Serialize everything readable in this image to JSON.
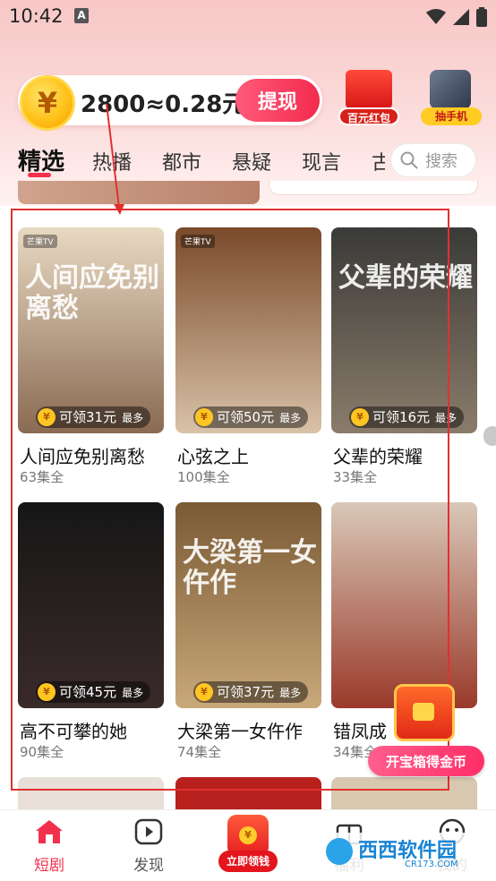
{
  "status_bar": {
    "time": "10:42",
    "app_letter": "A"
  },
  "coin": {
    "amount_text": "2800≈0.28元",
    "coin_symbol": "¥",
    "withdraw_label": "提现"
  },
  "promos": [
    {
      "label": "百元红包",
      "icon": "red-envelope"
    },
    {
      "label": "抽手机",
      "icon": "phone"
    }
  ],
  "tabs": [
    {
      "label": "精选",
      "active": true
    },
    {
      "label": "热播"
    },
    {
      "label": "都市"
    },
    {
      "label": "悬疑"
    },
    {
      "label": "现言"
    },
    {
      "label": "古"
    }
  ],
  "search": {
    "placeholder": "搜索"
  },
  "dramas": [
    {
      "title": "人间应免别离愁",
      "episodes": "63集全",
      "reward": "可领31元",
      "reward_suffix": "最多",
      "poster_text": "人间应免别离愁",
      "poster_brand": "芒果TV",
      "color_a": "#e8d9c2",
      "color_b": "#8a6a52"
    },
    {
      "title": "心弦之上",
      "episodes": "100集全",
      "reward": "可领50元",
      "reward_suffix": "最多",
      "poster_text": "",
      "poster_brand": "芒果TV",
      "color_a": "#7a4a2a",
      "color_b": "#d9c2a8"
    },
    {
      "title": "父辈的荣耀",
      "episodes": "33集全",
      "reward": "可领16元",
      "reward_suffix": "最多",
      "poster_text": "父辈的荣耀",
      "poster_brand": "",
      "color_a": "#3a3a38",
      "color_b": "#8a7c6a"
    },
    {
      "title": "高不可攀的她",
      "episodes": "90集全",
      "reward": "可领45元",
      "reward_suffix": "最多",
      "poster_text": "",
      "poster_brand": "",
      "color_a": "#161616",
      "color_b": "#3a2a2a"
    },
    {
      "title": "大梁第一女仵作",
      "episodes": "74集全",
      "reward": "可领37元",
      "reward_suffix": "最多",
      "poster_text": "大梁第一女仵作",
      "poster_brand": "",
      "color_a": "#7a5a34",
      "color_b": "#c9a87a"
    },
    {
      "title": "错凤成",
      "episodes": "34集全",
      "reward": "",
      "reward_suffix": "",
      "poster_text": "",
      "poster_brand": "",
      "color_a": "#d9c8b8",
      "color_b": "#9a3a2a"
    }
  ],
  "treasure": {
    "label": "开宝箱得金币"
  },
  "bottom_nav": [
    {
      "label": "短剧",
      "active": true
    },
    {
      "label": "发现"
    },
    {
      "label": "立即领钱"
    },
    {
      "label": "福利"
    },
    {
      "label": "我的"
    }
  ],
  "watermark": {
    "text": "西西软件园",
    "sub": "CR173.COM"
  },
  "colors": {
    "accent": "#f2304e",
    "annotation": "#e23030",
    "coin": "#ffc21a"
  }
}
